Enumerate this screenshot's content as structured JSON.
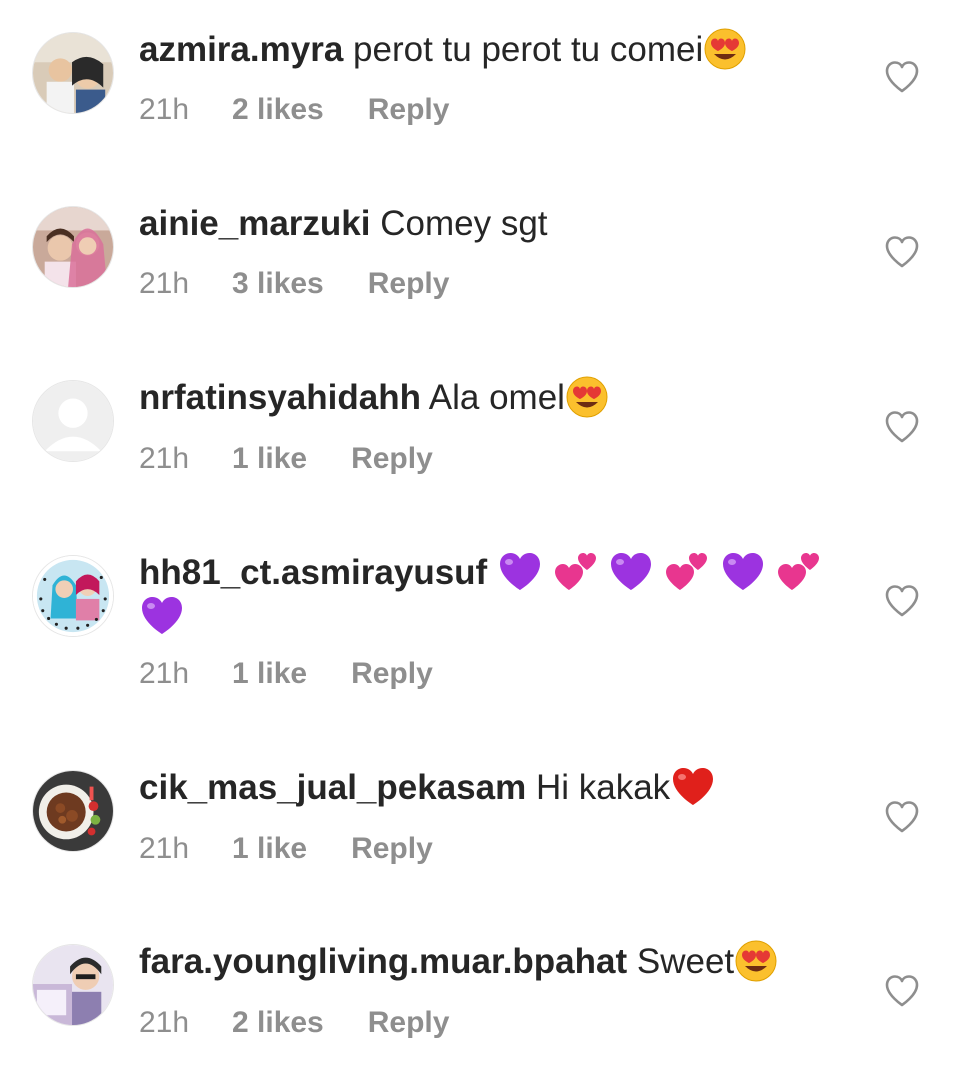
{
  "comments": [
    {
      "username": "azmira.myra",
      "text": "perot tu perot tu comei",
      "emojis": [
        "heart-eyes"
      ],
      "time": "21h",
      "likes": "2 likes",
      "reply_label": "Reply",
      "avatar": "photo-avatar"
    },
    {
      "username": "ainie_marzuki",
      "text": "Comey sgt",
      "emojis": [],
      "time": "21h",
      "likes": "3 likes",
      "reply_label": "Reply",
      "avatar": "photo-avatar"
    },
    {
      "username": "nrfatinsyahidahh",
      "text": "Ala omel",
      "emojis": [
        "heart-eyes"
      ],
      "time": "21h",
      "likes": "1 like",
      "reply_label": "Reply",
      "avatar": "default-avatar"
    },
    {
      "username": "hh81_ct.asmirayusuf",
      "text": "",
      "emojis": [
        "purple-heart",
        "two-hearts",
        "purple-heart",
        "two-hearts",
        "purple-heart",
        "two-hearts",
        "purple-heart"
      ],
      "time": "21h",
      "likes": "1 like",
      "reply_label": "Reply",
      "avatar": "photo-avatar"
    },
    {
      "username": "cik_mas_jual_pekasam",
      "text": "Hi kakak",
      "emojis": [
        "red-heart"
      ],
      "time": "21h",
      "likes": "1 like",
      "reply_label": "Reply",
      "avatar": "photo-avatar"
    },
    {
      "username": "fara.youngliving.muar.bpahat",
      "text": "Sweet",
      "emojis": [
        "heart-eyes"
      ],
      "time": "21h",
      "likes": "2 likes",
      "reply_label": "Reply",
      "avatar": "photo-avatar"
    }
  ],
  "colors": {
    "text": "#262626",
    "muted": "#8e8e8e",
    "heart_outline": "#8e8e8e"
  },
  "icons": {
    "like": "heart-outline-icon"
  }
}
